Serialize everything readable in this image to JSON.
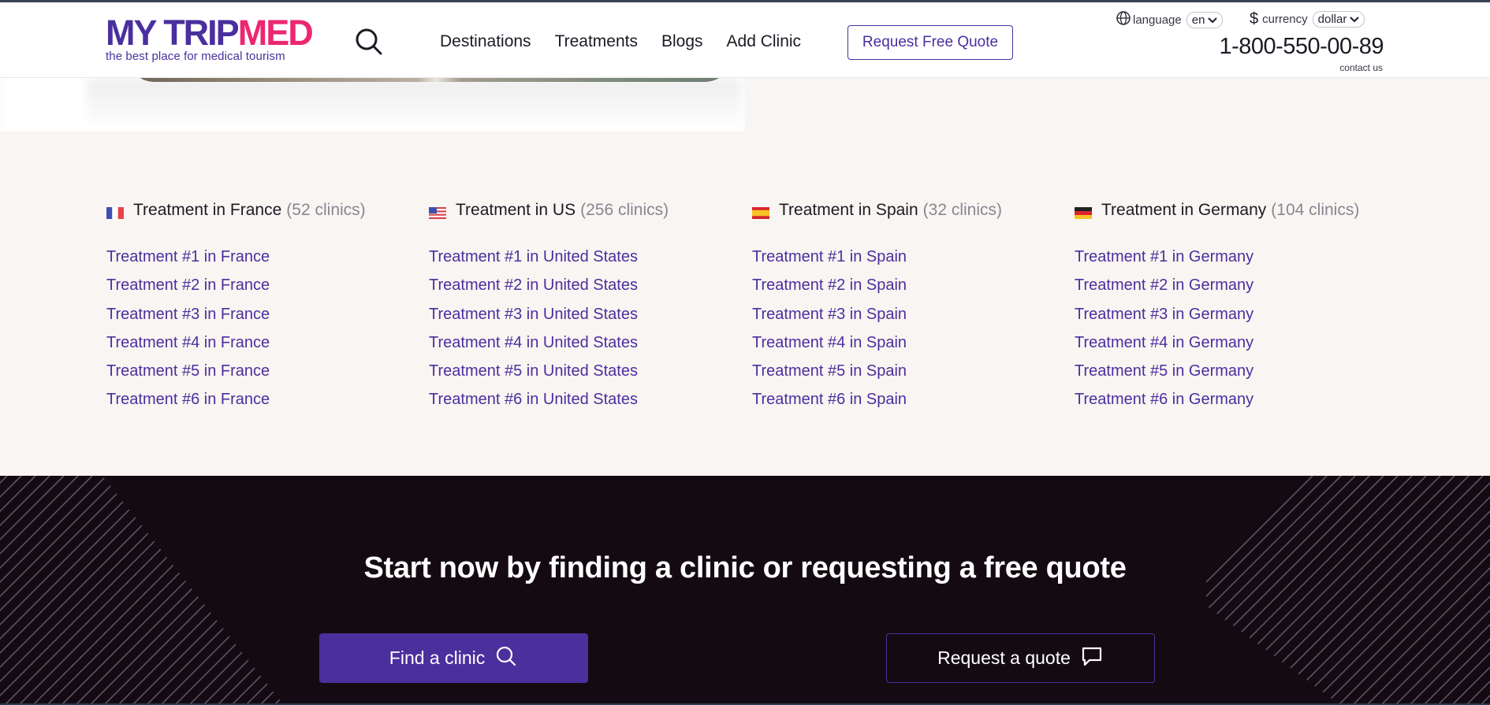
{
  "brand": {
    "name_part1": "MY TRIP",
    "name_part2": "MED",
    "tagline": "the best place for medical tourism",
    "colors": {
      "primary": "#4a2f9e",
      "accent": "#ec2771",
      "dark": "#140b12",
      "cream": "#f9f5f2"
    }
  },
  "header": {
    "search_icon": "search-icon",
    "nav": [
      "Destinations",
      "Treatments",
      "Blogs",
      "Add Clinic"
    ],
    "quote_button": "Request Free Quote",
    "language_label": "language",
    "language_value": "en",
    "currency_label": "currency",
    "currency_value": "dollar",
    "phone": "1-800-550-00-89",
    "contact": "contact us"
  },
  "treatments": [
    {
      "flag": "france-flag",
      "title": "Treatment in France",
      "count": "(52 clinics)",
      "links": [
        "Treatment #1 in France",
        "Treatment #2 in France",
        "Treatment #3 in France",
        "Treatment #4 in France",
        "Treatment #5 in France",
        "Treatment #6 in France"
      ]
    },
    {
      "flag": "us-flag",
      "title": "Treatment in US",
      "count": "(256 clinics)",
      "links": [
        "Treatment #1 in United States",
        "Treatment #2 in United States",
        "Treatment #3 in United States",
        "Treatment #4 in United States",
        "Treatment #5 in United States",
        "Treatment #6 in United States"
      ]
    },
    {
      "flag": "spain-flag",
      "title": "Treatment in Spain",
      "count": "(32 clinics)",
      "links": [
        "Treatment #1 in Spain",
        "Treatment #2 in Spain",
        "Treatment #3 in Spain",
        "Treatment #4 in Spain",
        "Treatment #5 in Spain",
        "Treatment #6 in Spain"
      ]
    },
    {
      "flag": "germany-flag",
      "title": "Treatment in Germany",
      "count": "(104 clinics)",
      "links": [
        "Treatment #1 in Germany",
        "Treatment #2 in Germany",
        "Treatment #3 in Germany",
        "Treatment #4 in Germany",
        "Treatment #5 in Germany",
        "Treatment #6 in Germany"
      ]
    }
  ],
  "cta": {
    "title": "Start now by finding a clinic or requesting a free quote",
    "find_button": "Find a clinic",
    "find_icon": "search-icon",
    "quote_button": "Request a quote",
    "quote_icon": "chat-bubble-icon"
  }
}
